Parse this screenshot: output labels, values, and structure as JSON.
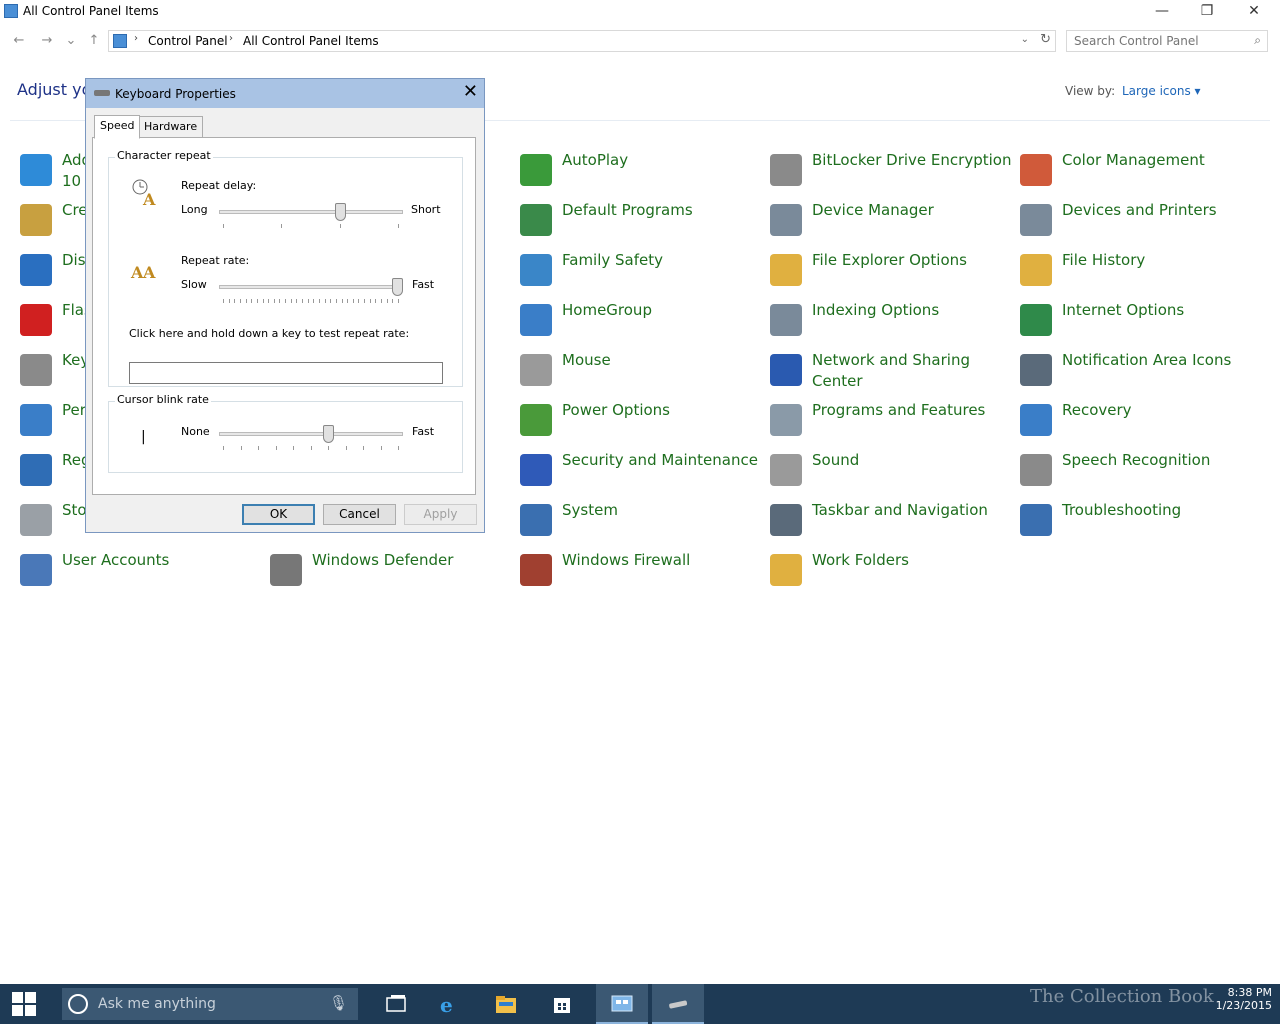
{
  "window": {
    "title": "All Control Panel Items",
    "minimize_glyph": "—",
    "maximize_glyph": "❐",
    "close_glyph": "✕"
  },
  "nav": {
    "back": "←",
    "forward": "→",
    "recent": "⌄",
    "up": "↑"
  },
  "address": {
    "crumbs": [
      "Control Panel",
      "All Control Panel Items"
    ],
    "separator": "›",
    "dropdown": "⌄",
    "refresh": "↻"
  },
  "search": {
    "placeholder": "Search Control Panel",
    "icon": "⌕"
  },
  "page": {
    "heading": "Adjust you",
    "view_by_label": "View by:",
    "view_by_value": "Large icons ▾"
  },
  "items": [
    {
      "label": "Add features to Windows 10 Tech Preview",
      "icon": "add-features-icon",
      "color": "#2e8bd8"
    },
    {
      "label": "Credential Manager",
      "icon": "credential-icon",
      "color": "#c8a040"
    },
    {
      "label": "Display",
      "icon": "display-icon",
      "color": "#2a6fc0"
    },
    {
      "label": "Flash Player",
      "icon": "flash-icon",
      "color": "#d02020"
    },
    {
      "label": "Keyboard",
      "icon": "keyboard-icon",
      "color": "#8a8a8a"
    },
    {
      "label": "Personalization",
      "icon": "personalization-icon",
      "color": "#3a7ec8"
    },
    {
      "label": "Region",
      "icon": "region-icon",
      "color": "#2f6db5"
    },
    {
      "label": "Storage Spaces",
      "icon": "storage-icon",
      "color": "#9aa0a6"
    },
    {
      "label": "User Accounts",
      "icon": "user-accounts-icon",
      "color": "#4a78b8"
    },
    {
      "label": "Windows Defender",
      "icon": "defender-icon",
      "color": "#777777"
    },
    {
      "label": "AutoPlay",
      "icon": "autoplay-icon",
      "color": "#3a9a3a"
    },
    {
      "label": "Default Programs",
      "icon": "default-programs-icon",
      "color": "#3a8a4a"
    },
    {
      "label": "Family Safety",
      "icon": "family-safety-icon",
      "color": "#3a86c8"
    },
    {
      "label": "HomeGroup",
      "icon": "homegroup-icon",
      "color": "#3a7ec8"
    },
    {
      "label": "Mouse",
      "icon": "mouse-icon",
      "color": "#9a9a9a"
    },
    {
      "label": "Power Options",
      "icon": "power-icon",
      "color": "#4a9a3a"
    },
    {
      "label": "Security and Maintenance",
      "icon": "flag-icon",
      "color": "#2f5ab8"
    },
    {
      "label": "System",
      "icon": "system-icon",
      "color": "#3a6fb0"
    },
    {
      "label": "Windows Firewall",
      "icon": "firewall-icon",
      "color": "#a04030"
    },
    {
      "label": "BitLocker Drive Encryption",
      "icon": "bitlocker-icon",
      "color": "#8a8a8a"
    },
    {
      "label": "Device Manager",
      "icon": "device-manager-icon",
      "color": "#7a8a9a"
    },
    {
      "label": "File Explorer Options",
      "icon": "folder-options-icon",
      "color": "#e0b040"
    },
    {
      "label": "Indexing Options",
      "icon": "indexing-icon",
      "color": "#7a8a9a"
    },
    {
      "label": "Network and Sharing Center",
      "icon": "network-icon",
      "color": "#2a5ab0"
    },
    {
      "label": "Programs and Features",
      "icon": "programs-icon",
      "color": "#8a9aa8"
    },
    {
      "label": "Sound",
      "icon": "sound-icon",
      "color": "#9a9a9a"
    },
    {
      "label": "Taskbar and Navigation",
      "icon": "taskbar-nav-icon",
      "color": "#5a6a7a"
    },
    {
      "label": "Work Folders",
      "icon": "work-folders-icon",
      "color": "#e0b040"
    },
    {
      "label": "Color Management",
      "icon": "color-mgmt-icon",
      "color": "#d05a3a"
    },
    {
      "label": "Devices and Printers",
      "icon": "printer-icon",
      "color": "#7a8a9a"
    },
    {
      "label": "File History",
      "icon": "file-history-icon",
      "color": "#e0b040"
    },
    {
      "label": "Internet Options",
      "icon": "internet-options-icon",
      "color": "#2f8a4a"
    },
    {
      "label": "Notification Area Icons",
      "icon": "notification-icon",
      "color": "#5a6a7a"
    },
    {
      "label": "Recovery",
      "icon": "recovery-icon",
      "color": "#3a7ec8"
    },
    {
      "label": "Speech Recognition",
      "icon": "microphone-icon",
      "color": "#8a8a8a"
    },
    {
      "label": "Troubleshooting",
      "icon": "troubleshooting-icon",
      "color": "#3a6fb0"
    }
  ],
  "dialog": {
    "title": "Keyboard Properties",
    "close": "✕",
    "tabs": [
      "Speed",
      "Hardware"
    ],
    "character_repeat": "Character repeat",
    "repeat_delay": "Repeat delay:",
    "long": "Long",
    "short": "Short",
    "repeat_rate": "Repeat rate:",
    "slow": "Slow",
    "fast": "Fast",
    "test_prompt": "Click here and hold down a key to test repeat rate:",
    "cursor_blink": "Cursor blink rate",
    "none": "None",
    "fast2": "Fast",
    "cursor_glyph": "|",
    "ok": "OK",
    "cancel": "Cancel",
    "apply": "Apply",
    "repeat_delay_level": 0.67,
    "repeat_rate_level": 1.0,
    "cursor_blink_level": 0.6
  },
  "taskbar": {
    "search_text": "Ask me anything",
    "mic": "🎙",
    "time": "8:38 PM",
    "date": "1/23/2015",
    "watermark": "The Collection Book"
  }
}
